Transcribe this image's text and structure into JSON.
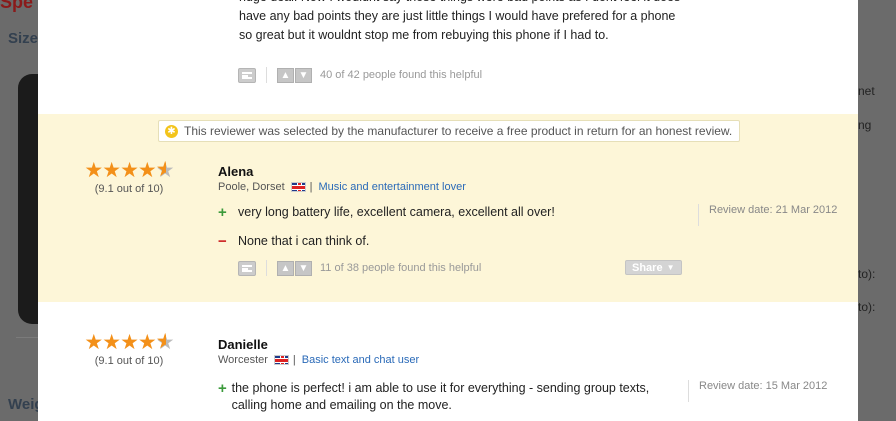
{
  "background": {
    "heading_size": "Size",
    "heading_weight": "Weig",
    "right_texts": [
      "net",
      "ng",
      "to):",
      "to):"
    ]
  },
  "top_review": {
    "text": "huge deal. Now I wouldnt say those things were bad points as I dont feel it does have any bad points they are just little things I would have prefered for a phone so great but it wouldnt stop me from rebuying this phone if I had to.",
    "helpful": "40 of 42 people found this helpful"
  },
  "notice": {
    "text": "This reviewer was selected by the manufacturer to receive a free product in return for an honest review."
  },
  "reviews": [
    {
      "stars": 4.5,
      "rating_text": "(9.1 out of 10)",
      "name": "Alena",
      "location": "Poole, Dorset",
      "persona": "Music and entertainment lover",
      "pro": "very long battery life, excellent camera, excellent all over!",
      "con": "None that i can think of.",
      "review_date": "Review date: 21 Mar 2012",
      "helpful": "11 of 38 people found this helpful",
      "share_label": "Share"
    },
    {
      "stars": 4.5,
      "rating_text": "(9.1 out of 10)",
      "name": "Danielle",
      "location": "Worcester",
      "persona": "Basic text and chat user",
      "pro": "the phone is perfect! i am able to use it for everything - sending group texts, calling home and emailing on the move.",
      "review_date": "Review date: 15 Mar 2012"
    }
  ],
  "colors": {
    "accent_star": "#f39019",
    "link": "#2a6ab8",
    "highlight_bg": "#fdf6d8"
  }
}
